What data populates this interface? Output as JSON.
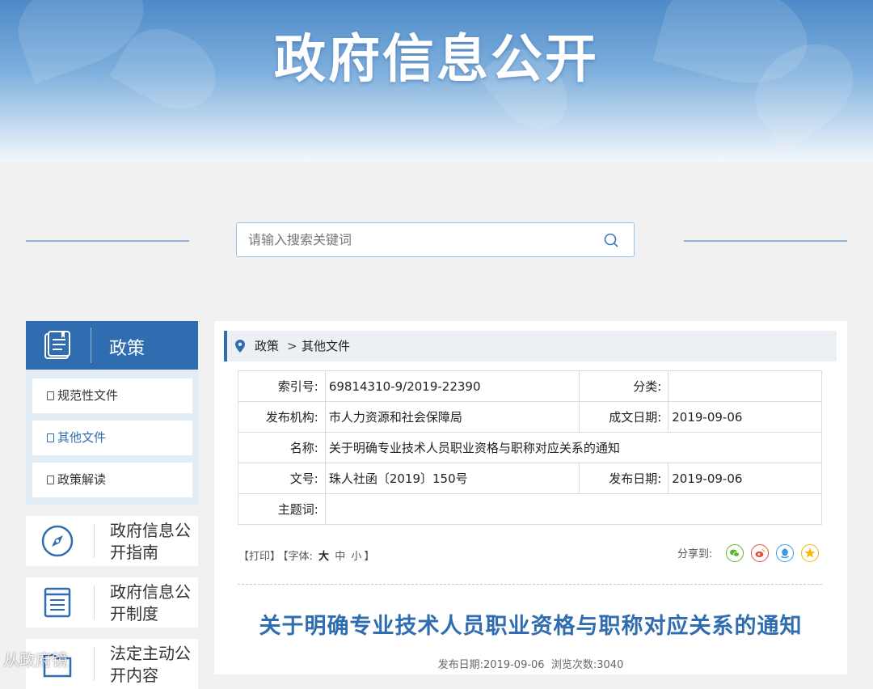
{
  "banner": {
    "title": "政府信息公开"
  },
  "search": {
    "placeholder": "请输入搜索关键词"
  },
  "sidebar": {
    "header": "政策",
    "items": [
      {
        "label": "规范性文件"
      },
      {
        "label": "其他文件"
      },
      {
        "label": "政策解读"
      }
    ],
    "cards": [
      {
        "label": "政府信息公开指南",
        "icon": "compass-icon"
      },
      {
        "label": "政府信息公开制度",
        "icon": "list-document-icon"
      },
      {
        "label": "法定主动公开内容",
        "icon": "folder-icon"
      }
    ]
  },
  "breadcrumb": {
    "level1": "政策",
    "separator": ">",
    "level2": "其他文件"
  },
  "meta": {
    "index_label": "索引号:",
    "index_value": "69814310-9/2019-22390",
    "category_label": "分类:",
    "category_value": "",
    "publisher_label": "发布机构:",
    "publisher_value": "市人力资源和社会保障局",
    "created_label": "成文日期:",
    "created_value": "2019-09-06",
    "name_label": "名称:",
    "name_value": "关于明确专业技术人员职业资格与职称对应关系的通知",
    "docno_label": "文号:",
    "docno_value": "珠人社函〔2019〕150号",
    "published_label": "发布日期:",
    "published_value": "2019-09-06",
    "keywords_label": "主题词:",
    "keywords_value": ""
  },
  "tools": {
    "print": "【打印】",
    "font_label": "【字体:",
    "large": "大",
    "medium": "中",
    "small": "小",
    "close": "】"
  },
  "share": {
    "label": "分享到:",
    "icons": [
      "wechat-icon",
      "weibo-icon",
      "qq-icon",
      "qzone-icon"
    ],
    "colors": [
      "#5cb531",
      "#e0533b",
      "#3a9be0",
      "#f5b800"
    ]
  },
  "article": {
    "title": "关于明确专业技术人员职业资格与职称对应关系的通知",
    "date_label": "发布日期:",
    "date": "2019-09-06",
    "views_label": "浏览次数:",
    "views": "3040"
  },
  "watermark": "从政府镜"
}
